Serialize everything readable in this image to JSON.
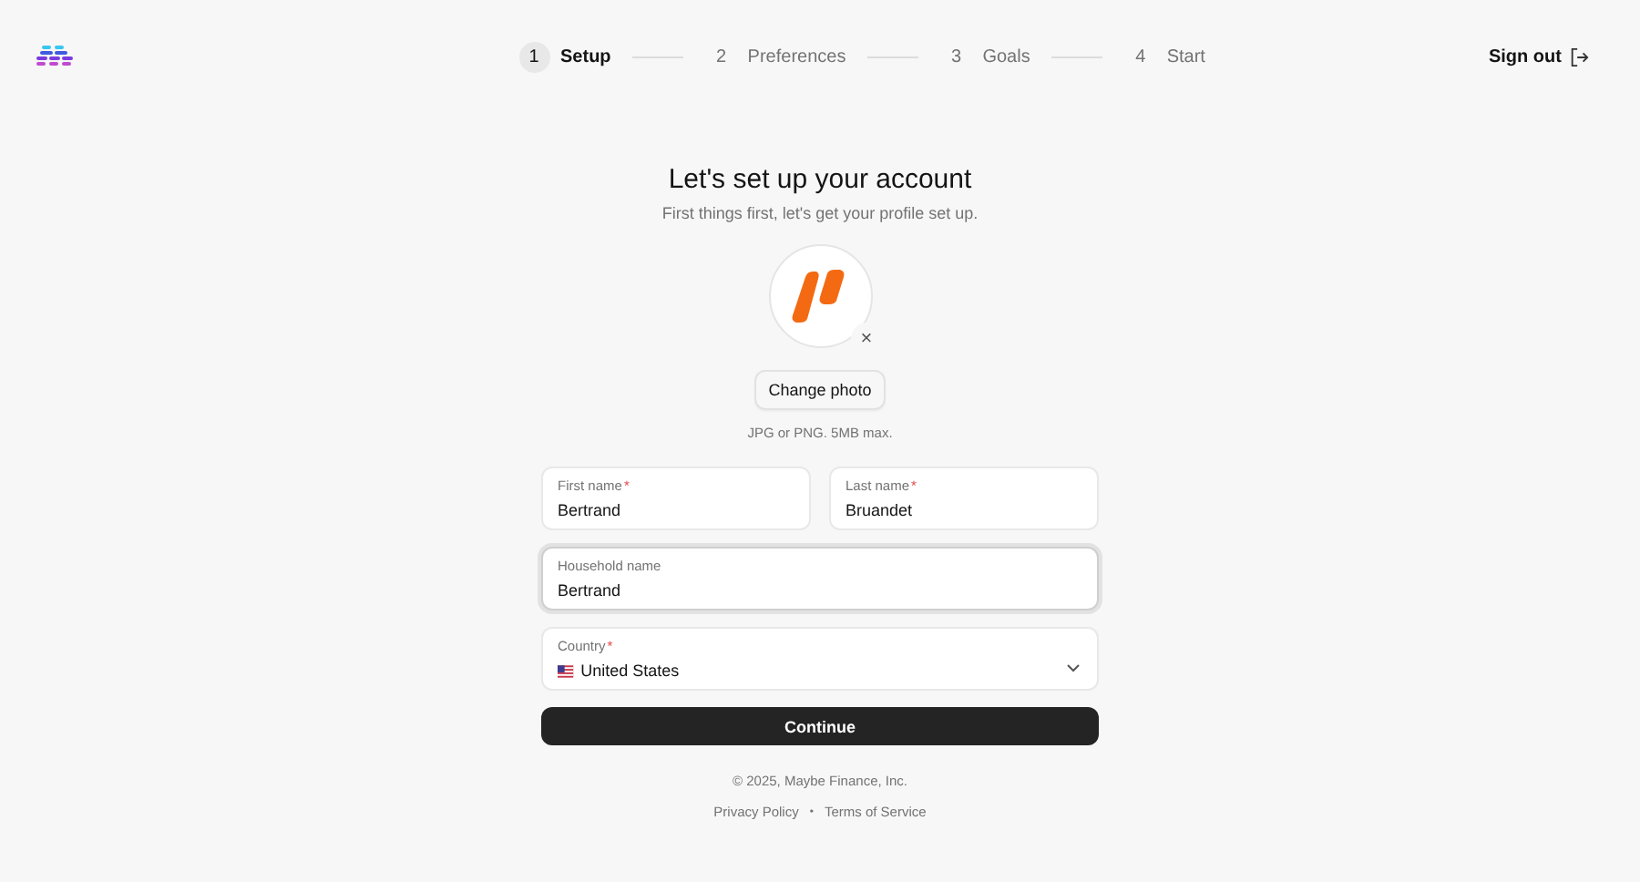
{
  "steps": [
    {
      "number": "1",
      "label": "Setup",
      "selected": true
    },
    {
      "number": "2",
      "label": "Preferences",
      "selected": false
    },
    {
      "number": "3",
      "label": "Goals",
      "selected": false
    },
    {
      "number": "4",
      "label": "Start",
      "selected": false
    }
  ],
  "sign_out": "Sign out",
  "title": "Let's set up your account",
  "subtitle": "First things first, let's get your profile set up.",
  "photo": {
    "remove": "×",
    "button": "Change photo",
    "hint": "JPG or PNG. 5MB max."
  },
  "fields": [
    {
      "kind": "text",
      "label": "First name",
      "required_mark": "*",
      "value": "Bertrand",
      "focused": false
    },
    {
      "kind": "text",
      "label": "Last name",
      "required_mark": "*",
      "value": "Bruandet",
      "focused": false
    },
    {
      "kind": "text",
      "label": "Household name",
      "value": "Bertrand",
      "focused": true
    },
    {
      "kind": "select",
      "label": "Country",
      "required_mark": "*",
      "value": "United States",
      "focused": false
    }
  ],
  "continue": "Continue",
  "footer": {
    "copyright": "© 2025, Maybe Finance, Inc.",
    "links": [
      "Privacy Policy",
      "Terms of Service"
    ],
    "separator": "•"
  }
}
